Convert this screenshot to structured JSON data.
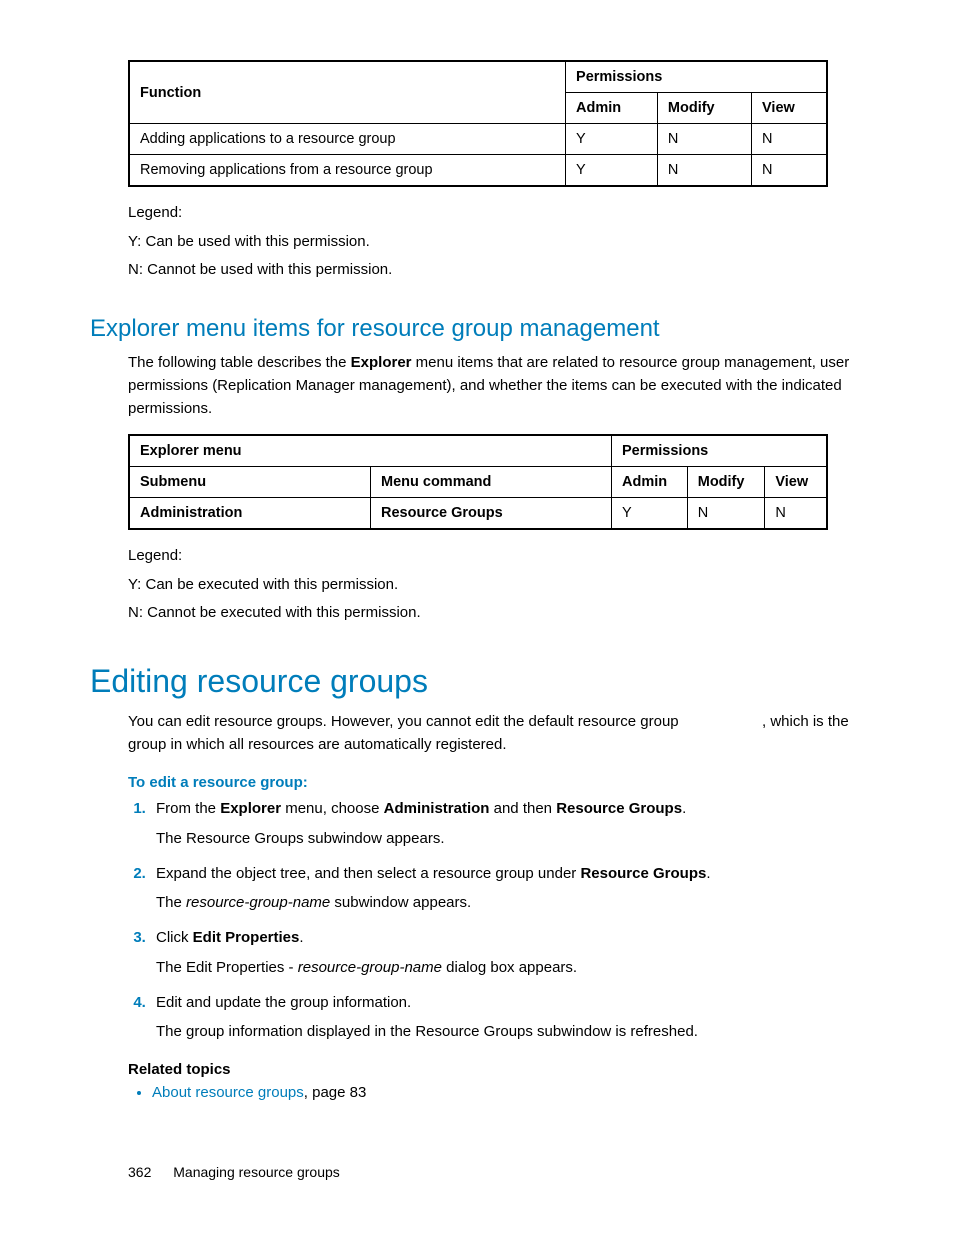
{
  "table1": {
    "header": {
      "function": "Function",
      "permissions": "Permissions",
      "admin": "Admin",
      "modify": "Modify",
      "view": "View"
    },
    "rows": [
      {
        "function": "Adding applications to a resource group",
        "admin": "Y",
        "modify": "N",
        "view": "N"
      },
      {
        "function": "Removing applications from a resource group",
        "admin": "Y",
        "modify": "N",
        "view": "N"
      }
    ]
  },
  "legend1": {
    "title": "Legend:",
    "y": "Y: Can be used with this permission.",
    "n": "N: Cannot be used with this permission."
  },
  "section1": {
    "heading": "Explorer menu items for resource group management",
    "intro_a": "The following table describes the ",
    "intro_bold": "Explorer",
    "intro_b": " menu items that are related to resource group management, user permissions (Replication Manager management), and whether the items can be executed with the indicated permissions."
  },
  "table2": {
    "header": {
      "explorer": "Explorer menu",
      "permissions": "Permissions",
      "submenu": "Submenu",
      "command": "Menu command",
      "admin": "Admin",
      "modify": "Modify",
      "view": "View"
    },
    "row": {
      "submenu": "Administration",
      "command": "Resource Groups",
      "admin": "Y",
      "modify": "N",
      "view": "N"
    }
  },
  "legend2": {
    "title": "Legend:",
    "y": "Y: Can be executed with this permission.",
    "n": "N: Cannot be executed with this permission."
  },
  "section2": {
    "heading": "Editing resource groups",
    "intro": "You can edit resource groups. However, you cannot edit the default resource group",
    "intro_tail": ", which is the group in which all resources are automatically registered.",
    "procedure_title": "To edit a resource group:",
    "steps": {
      "s1a": "From the ",
      "s1b": "Explorer",
      "s1c": " menu, choose ",
      "s1d": "Administration",
      "s1e": " and then ",
      "s1f": "Resource Groups",
      "s1g": ".",
      "s1sub": "The Resource Groups subwindow appears.",
      "s2a": "Expand the object tree, and then select a resource group under ",
      "s2b": "Resource Groups",
      "s2c": ".",
      "s2sub_a": "The ",
      "s2sub_i": "resource-group-name",
      "s2sub_b": " subwindow appears.",
      "s3a": "Click ",
      "s3b": "Edit Properties",
      "s3c": ".",
      "s3sub_a": "The Edit Properties - ",
      "s3sub_i": "resource-group-name",
      "s3sub_b": " dialog box appears.",
      "s4": "Edit and update the group information.",
      "s4sub": "The group information displayed in the Resource Groups subwindow is refreshed."
    },
    "related_title": "Related topics",
    "related_link": "About resource groups",
    "related_tail": ", page 83"
  },
  "footer": {
    "page": "362",
    "title": "Managing resource groups"
  }
}
